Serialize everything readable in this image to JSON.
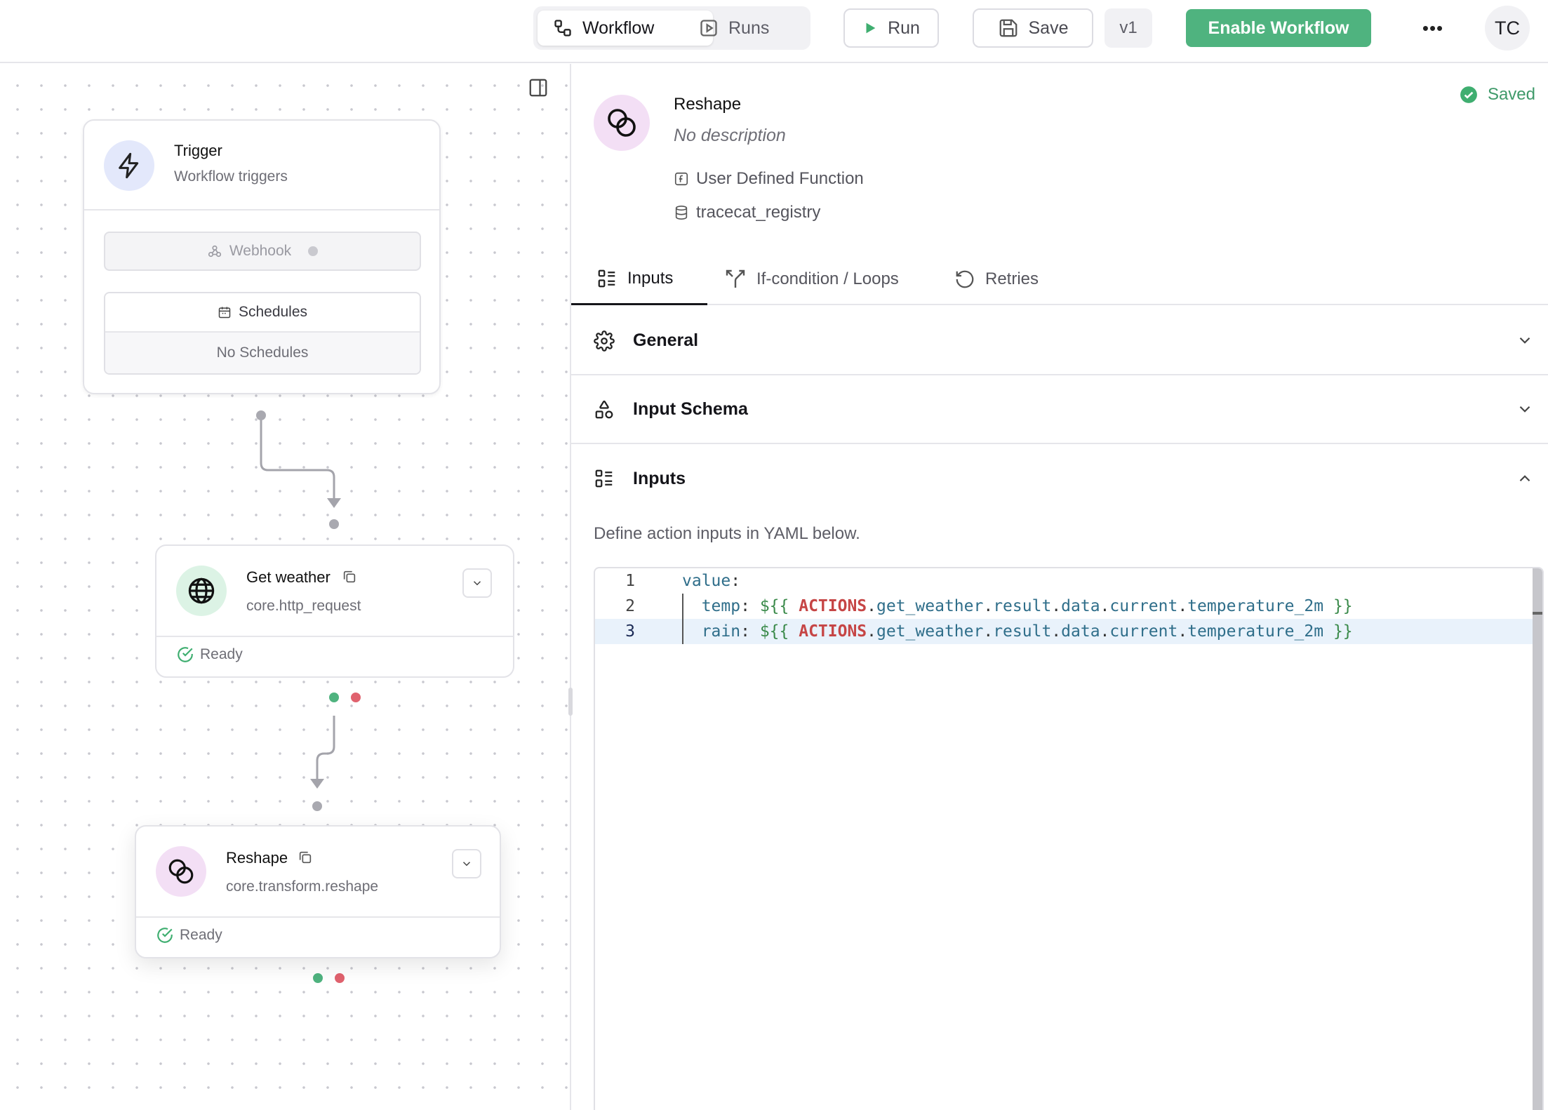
{
  "topbar": {
    "tabs": [
      {
        "label": "Workflow",
        "icon": "workflow-icon",
        "active": true
      },
      {
        "label": "Runs",
        "icon": "play-square-icon",
        "active": false
      }
    ],
    "run_label": "Run",
    "save_label": "Save",
    "version": "v1",
    "enable_label": "Enable Workflow",
    "more_label": "•••",
    "avatar_initials": "TC"
  },
  "canvas": {
    "trigger": {
      "title": "Trigger",
      "subtitle": "Workflow triggers",
      "webhook_label": "Webhook",
      "schedules_label": "Schedules",
      "schedules_empty": "No Schedules"
    },
    "nodes": [
      {
        "title": "Get weather",
        "subtitle": "core.http_request",
        "status": "Ready",
        "icon": "globe-icon"
      },
      {
        "title": "Reshape",
        "subtitle": "core.transform.reshape",
        "status": "Ready",
        "icon": "reshape-icon"
      }
    ]
  },
  "detail": {
    "saved_label": "Saved",
    "title": "Reshape",
    "description": "No description",
    "type_label": "User Defined Function",
    "registry_label": "tracecat_registry",
    "tabs": [
      {
        "label": "Inputs",
        "active": true
      },
      {
        "label": "If-condition / Loops",
        "active": false
      },
      {
        "label": "Retries",
        "active": false
      }
    ],
    "sections": {
      "general": "General",
      "schema": "Input Schema",
      "inputs": "Inputs"
    },
    "inputs_help": "Define action inputs in YAML below.",
    "code_lines": [
      {
        "no": "1",
        "text": "value:"
      },
      {
        "no": "2",
        "text": "  temp: ${{ ACTIONS.get_weather.result.data.current.temperature_2m }}"
      },
      {
        "no": "3",
        "text": "  rain: ${{ ACTIONS.get_weather.result.data.current.temperature_2m }}"
      }
    ]
  },
  "colors": {
    "accent_green": "#4fb37f",
    "error_red": "#e0626e",
    "reshape_bg": "#f3dff5"
  }
}
